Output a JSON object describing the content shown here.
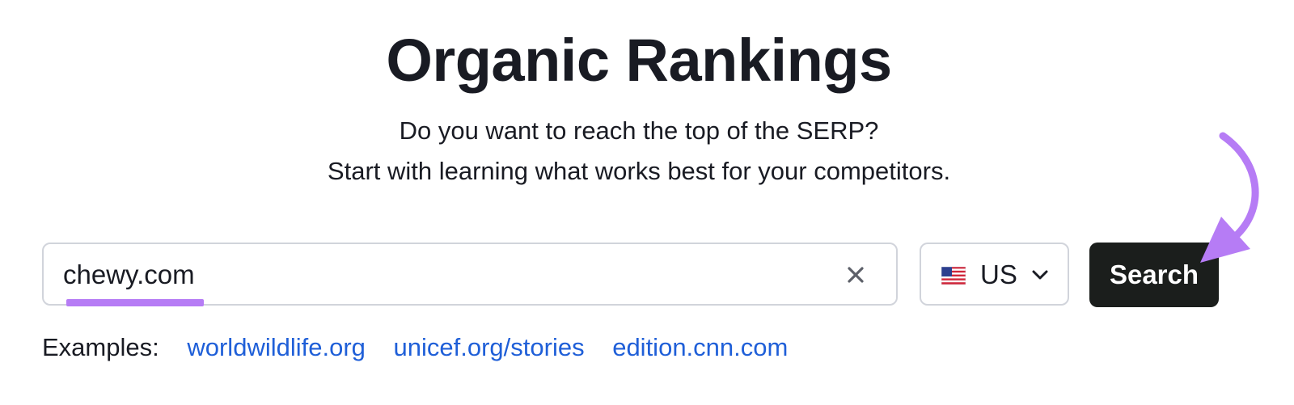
{
  "header": {
    "title": "Organic Rankings",
    "subtitle_line1": "Do you want to reach the top of the SERP?",
    "subtitle_line2": "Start with learning what works best for your competitors."
  },
  "search": {
    "value": "chewy.com",
    "clear_icon": "close-icon",
    "underline_color": "#b67cf5"
  },
  "country": {
    "label": "US",
    "flag_icon": "us-flag-icon",
    "chevron_icon": "chevron-down-icon"
  },
  "search_button": {
    "label": "Search",
    "background": "#1b1e1c"
  },
  "examples": {
    "label": "Examples:",
    "links": [
      "worldwildlife.org",
      "unicef.org/stories",
      "edition.cnn.com"
    ],
    "link_color": "#1f5fd8"
  },
  "annotation": {
    "arrow_icon": "curved-arrow-icon",
    "color": "#b67cf5"
  }
}
